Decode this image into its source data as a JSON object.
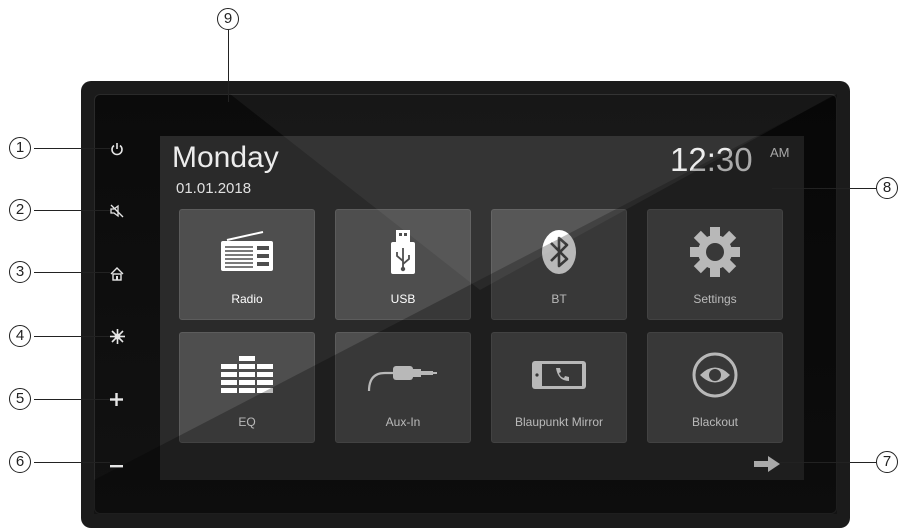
{
  "screen": {
    "day": "Monday",
    "date": "01.01.2018",
    "time": "12:30",
    "ampm": "AM"
  },
  "apps": [
    {
      "label": "Radio",
      "icon": "radio-icon"
    },
    {
      "label": "USB",
      "icon": "usb-icon"
    },
    {
      "label": "BT",
      "icon": "bluetooth-icon"
    },
    {
      "label": "Settings",
      "icon": "gear-icon"
    },
    {
      "label": "EQ",
      "icon": "equalizer-icon"
    },
    {
      "label": "Aux-In",
      "icon": "aux-cable-icon"
    },
    {
      "label": "Blaupunkt Mirror",
      "icon": "phone-mirror-icon"
    },
    {
      "label": "Blackout",
      "icon": "eye-icon"
    }
  ],
  "hardware_buttons": [
    {
      "name": "power-button",
      "icon": "power-icon",
      "glyph": "⏻"
    },
    {
      "name": "mute-button",
      "icon": "mute-icon",
      "glyph": "🔇"
    },
    {
      "name": "home-button",
      "icon": "home-icon",
      "glyph": "⌂"
    },
    {
      "name": "brightness-button",
      "icon": "sun-icon",
      "glyph": "✳"
    },
    {
      "name": "volume-up-button",
      "icon": "plus-icon",
      "glyph": "+"
    },
    {
      "name": "volume-down-button",
      "icon": "minus-icon",
      "glyph": "−"
    }
  ],
  "next_page_arrow": "arrow-right-icon",
  "callouts": [
    "1",
    "2",
    "3",
    "4",
    "5",
    "6",
    "7",
    "8",
    "9"
  ],
  "colors": {
    "tile": "#4e4e4e",
    "screen": "#2a2a2a",
    "bezel": "#111111",
    "text": "#ececec"
  }
}
